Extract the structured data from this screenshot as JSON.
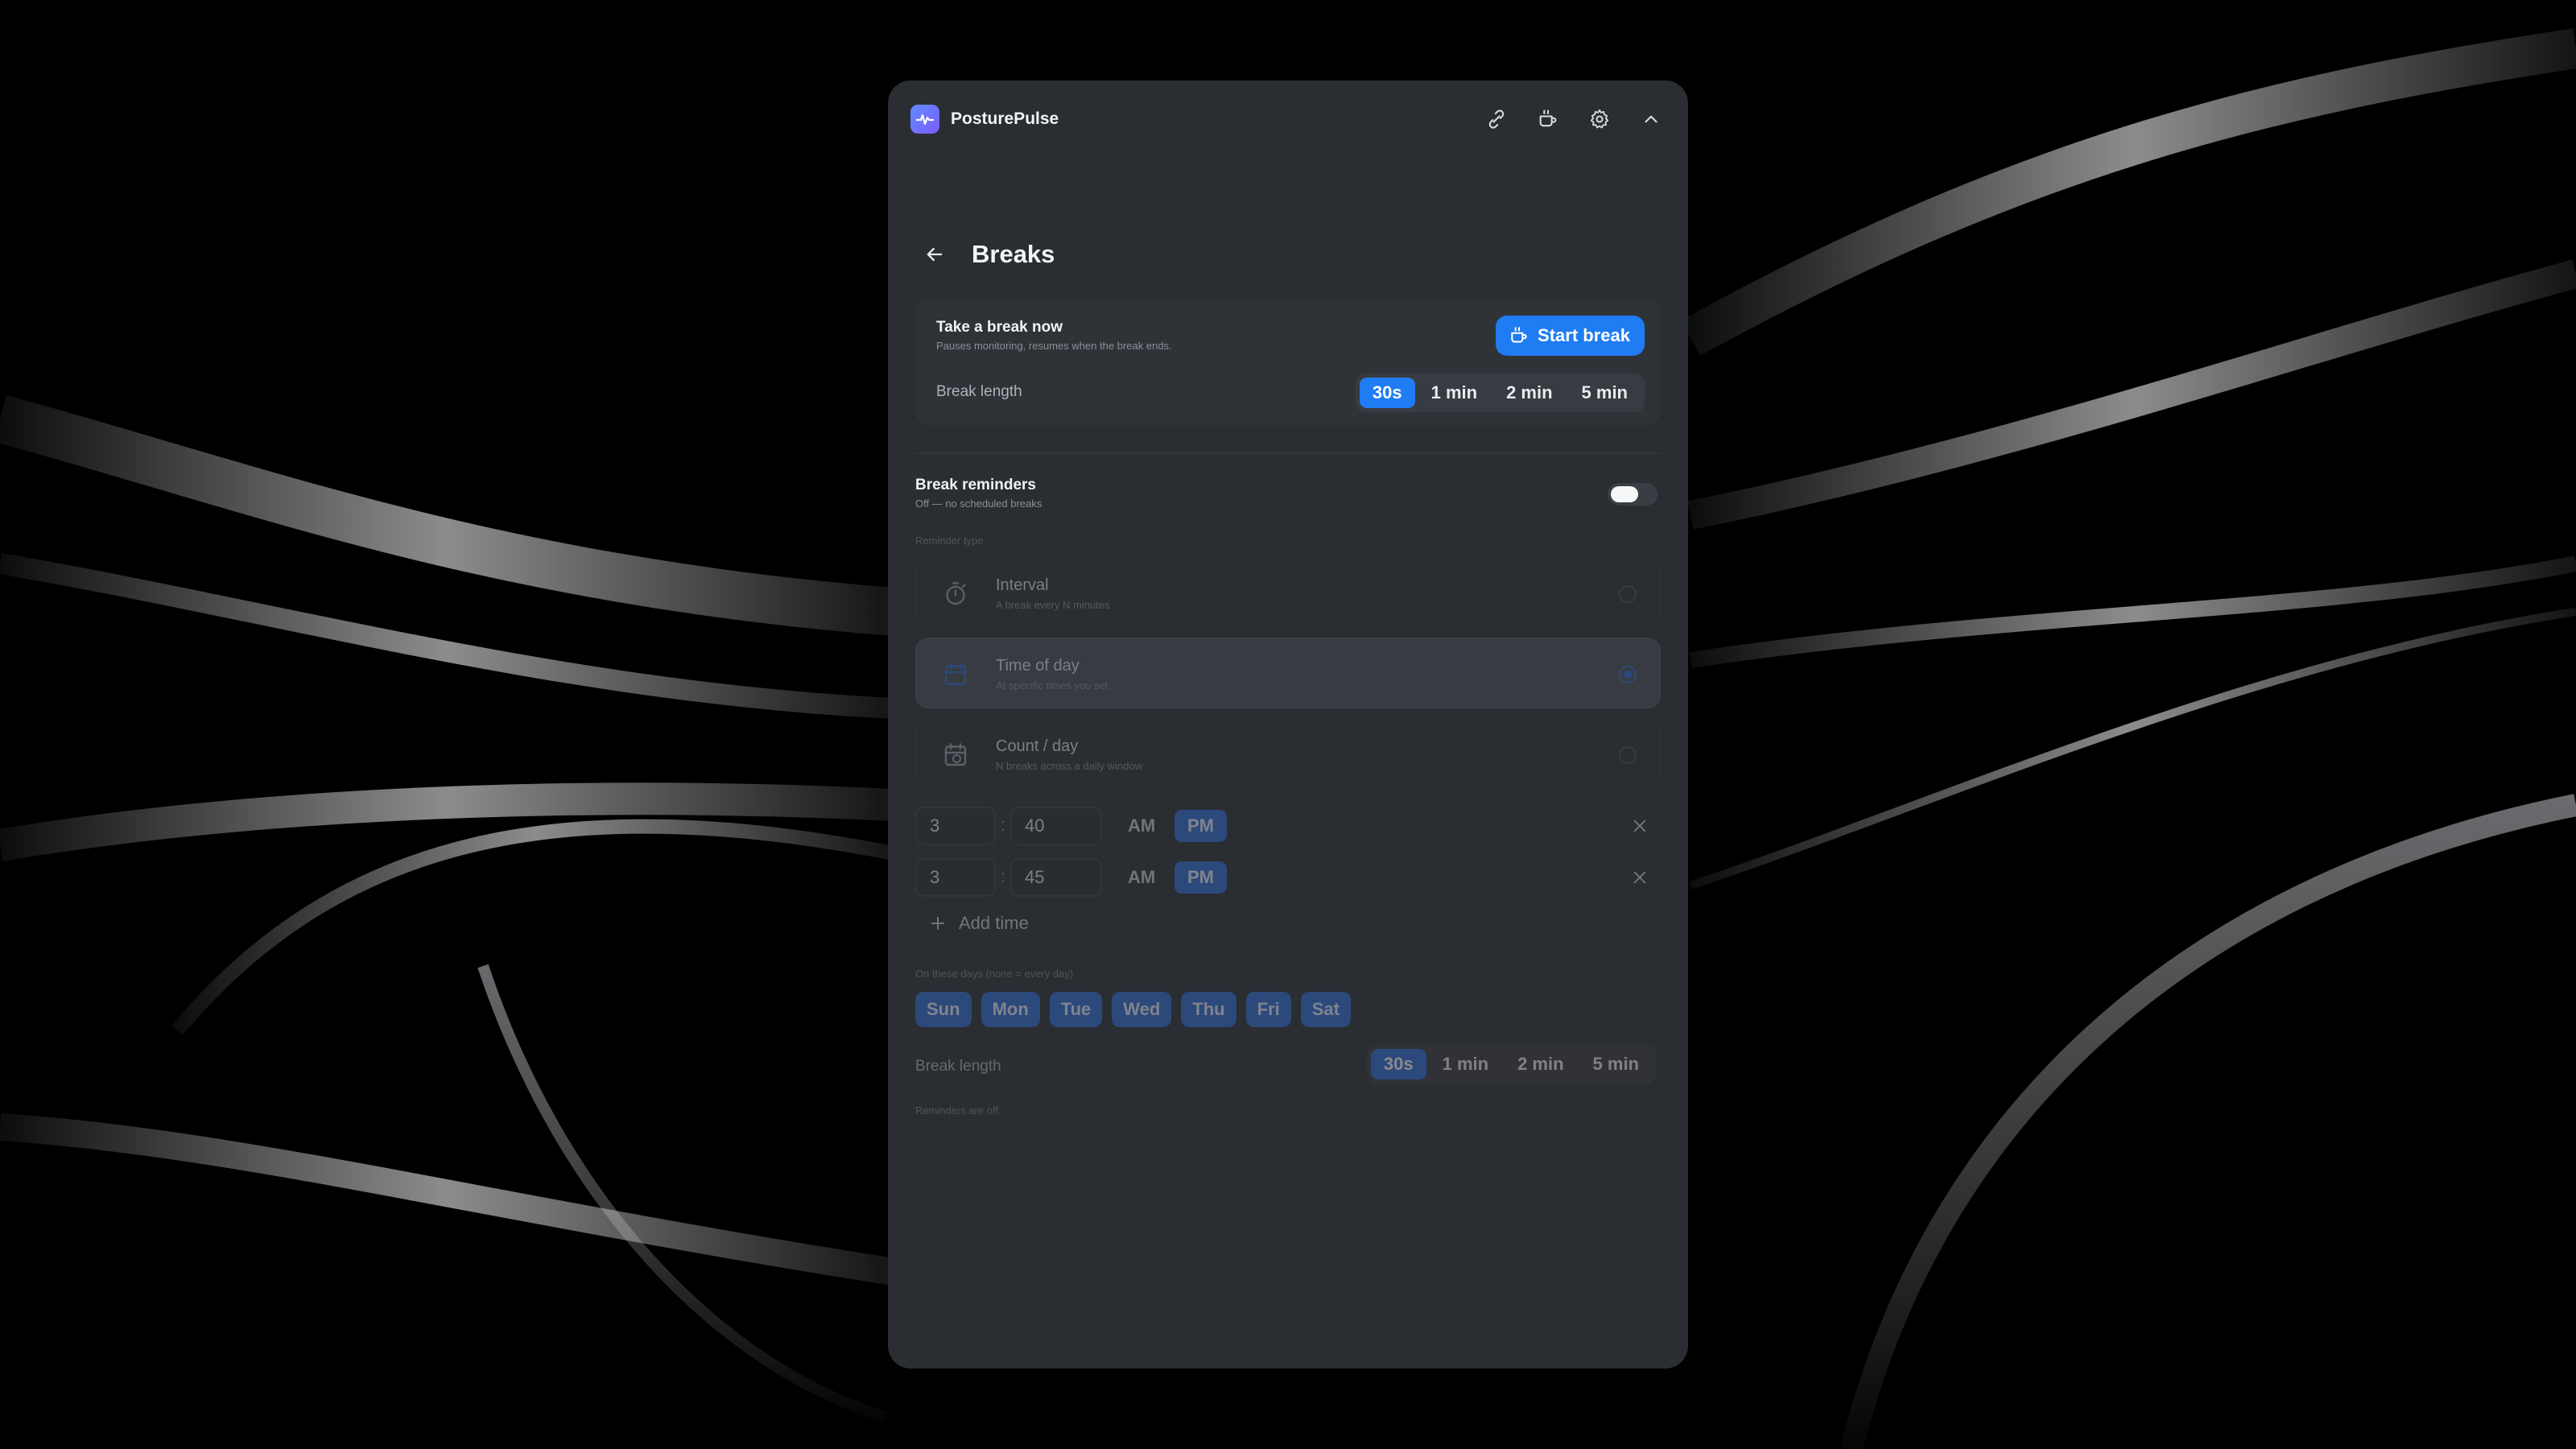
{
  "app": {
    "name": "PosturePulse"
  },
  "header": {
    "title": "Breaks"
  },
  "take_break": {
    "title": "Take a break now",
    "subtitle": "Pauses monitoring, resumes when the break ends.",
    "start_label": "Start break",
    "length_label": "Break length",
    "lengths": [
      "30s",
      "1 min",
      "2 min",
      "5 min"
    ],
    "selected_length": "30s"
  },
  "reminders": {
    "title": "Break reminders",
    "subtitle": "Off — no scheduled breaks",
    "enabled": false,
    "type_label": "Reminder type",
    "types": [
      {
        "name": "Interval",
        "desc": "A break every N minutes",
        "icon": "timer-icon",
        "selected": false
      },
      {
        "name": "Time of day",
        "desc": "At specific times you set",
        "icon": "calendar-icon",
        "selected": true
      },
      {
        "name": "Count / day",
        "desc": "N breaks across a daily window",
        "icon": "calendar-clock-icon",
        "selected": false
      }
    ],
    "times": [
      {
        "hour": "3",
        "minute": "40",
        "am": "AM",
        "pm": "PM",
        "period": "PM"
      },
      {
        "hour": "3",
        "minute": "45",
        "am": "AM",
        "pm": "PM",
        "period": "PM"
      }
    ],
    "add_time_label": "Add time",
    "days_label": "On these days (none = every day)",
    "days": [
      "Sun",
      "Mon",
      "Tue",
      "Wed",
      "Thu",
      "Fri",
      "Sat"
    ],
    "length_label": "Break length",
    "lengths": [
      "30s",
      "1 min",
      "2 min",
      "5 min"
    ],
    "selected_length": "30s",
    "footer_note": "Reminders are off."
  },
  "colors": {
    "accent": "#1f7cf2",
    "accent_muted": "#2f6fd6",
    "panel": "#2a2d31"
  }
}
